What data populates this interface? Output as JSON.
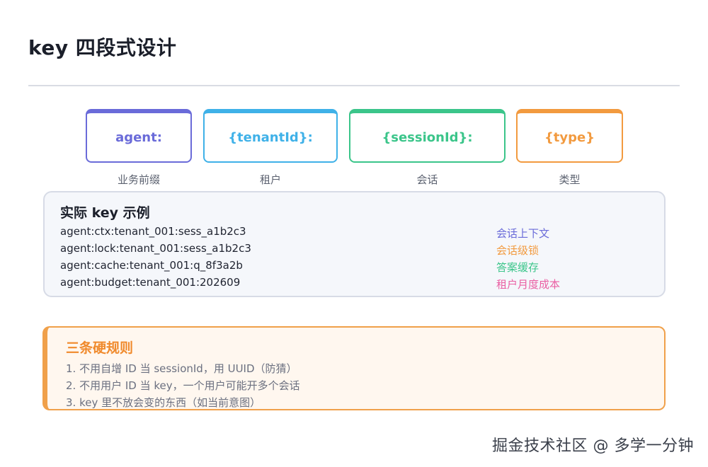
{
  "title": "key 四段式设计",
  "segments": [
    {
      "text": "agent:",
      "label": "业务前缀",
      "color": "#6a6bd9"
    },
    {
      "text": "{tenantId}:",
      "label": "租户",
      "color": "#3fb1e8"
    },
    {
      "text": "{sessionId}:",
      "label": "会话",
      "color": "#3bc58a"
    },
    {
      "text": "{type}",
      "label": "类型",
      "color": "#f29a3f"
    }
  ],
  "examples": {
    "title": "实际 key 示例",
    "items": [
      {
        "key": "agent:ctx:tenant_001:sess_a1b2c3",
        "desc": "会话上下文",
        "color": "#6a6bd9"
      },
      {
        "key": "agent:lock:tenant_001:sess_a1b2c3",
        "desc": "会话级锁",
        "color": "#f29a3f"
      },
      {
        "key": "agent:cache:tenant_001:q_8f3a2b",
        "desc": "答案缓存",
        "color": "#3bc58a"
      },
      {
        "key": "agent:budget:tenant_001:202609",
        "desc": "租户月度成本",
        "color": "#ea5fa3"
      }
    ]
  },
  "rules": {
    "title": "三条硬规则",
    "items": [
      "1. 不用自增 ID 当 sessionId，用 UUID（防猜）",
      "2. 不用用户 ID 当 key，一个用户可能开多个会话",
      "3. key 里不放会变的东西（如当前意图）"
    ]
  },
  "watermark": "掘金技术社区 @ 多学一分钟"
}
